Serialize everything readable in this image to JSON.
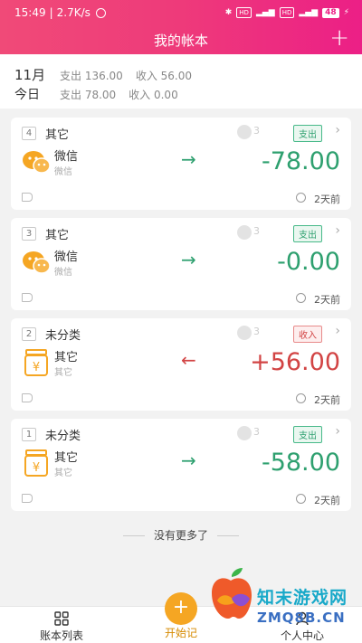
{
  "status": {
    "time": "15:49",
    "speed": "2.7K/s",
    "battery": "48"
  },
  "header": {
    "title": "我的帐本",
    "add_label": "+"
  },
  "summary": {
    "month": {
      "label": "11月",
      "expense": "支出 136.00",
      "income": "收入 56.00"
    },
    "today": {
      "label": "今日",
      "expense": "支出 78.00",
      "income": "收入 0.00"
    }
  },
  "records": [
    {
      "no": "4",
      "category": "其它",
      "user_mask": "3",
      "type": "支出",
      "account": "微信",
      "account_sub": "微信",
      "arrow": "→",
      "amount": "-78.00",
      "time": "2天前"
    },
    {
      "no": "3",
      "category": "其它",
      "user_mask": "3",
      "type": "支出",
      "account": "微信",
      "account_sub": "微信",
      "arrow": "→",
      "amount": "-0.00",
      "time": "2天前"
    },
    {
      "no": "2",
      "category": "未分类",
      "user_mask": "3",
      "type": "收入",
      "account": "其它",
      "account_sub": "其它",
      "arrow": "←",
      "amount": "+56.00",
      "time": "2天前"
    },
    {
      "no": "1",
      "category": "未分类",
      "user_mask": "3",
      "type": "支出",
      "account": "其它",
      "account_sub": "其它",
      "arrow": "→",
      "amount": "-58.00",
      "time": "2天前"
    }
  ],
  "no_more": "没有更多了",
  "tabs": {
    "list": "账本列表",
    "record": "开始记",
    "profile": "个人中心"
  },
  "watermark": {
    "line1": "知末游戏网",
    "line2": "ZMQ8B.CN"
  },
  "colors": {
    "header_start": "#f04a78",
    "header_end": "#ec1f86",
    "expense": "#2ea06f",
    "income": "#d24444",
    "accent": "#f5a623"
  }
}
